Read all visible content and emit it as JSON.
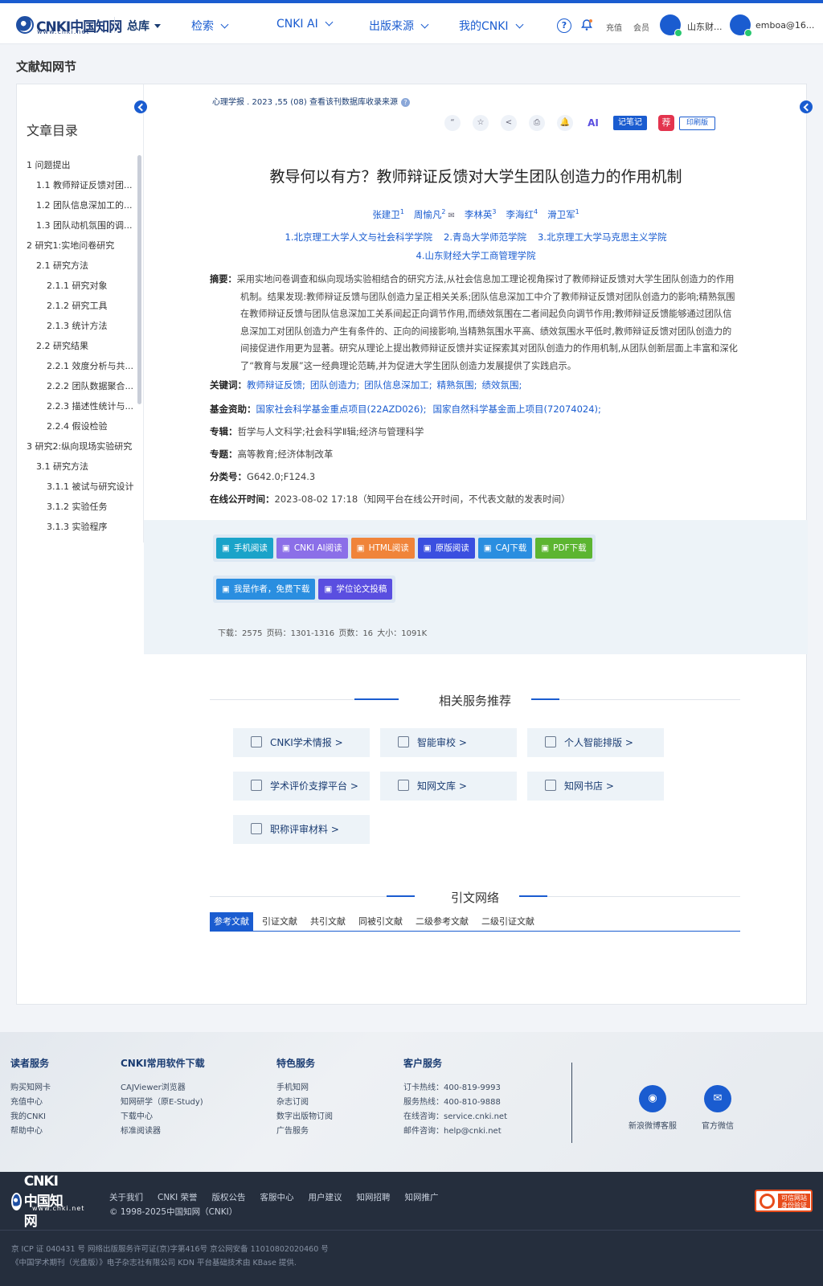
{
  "nav": {
    "logo_text": "CNKI中国知网",
    "logo_sub": "www.cnki.net",
    "items": [
      "总库",
      "检索",
      "CNKI AI",
      "出版来源",
      "我的CNKI"
    ],
    "recharge": "充值",
    "member": "会员",
    "institution": "山东财...",
    "user": "emboa@16..."
  },
  "page_title": "文献知网节",
  "sidebar": {
    "title": "文章目录",
    "toc": [
      {
        "level": 1,
        "text": "1 问题提出"
      },
      {
        "level": 2,
        "text": "1.1 教师辩证反馈对团..."
      },
      {
        "level": 2,
        "text": "1.2 团队信息深加工的..."
      },
      {
        "level": 2,
        "text": "1.3 团队动机氛围的调..."
      },
      {
        "level": 1,
        "text": "2 研究1:实地问卷研究"
      },
      {
        "level": 2,
        "text": "2.1 研究方法"
      },
      {
        "level": 3,
        "text": "2.1.1 研究对象"
      },
      {
        "level": 3,
        "text": "2.1.2 研究工具"
      },
      {
        "level": 3,
        "text": "2.1.3 统计方法"
      },
      {
        "level": 2,
        "text": "2.2 研究结果"
      },
      {
        "level": 3,
        "text": "2.2.1 效度分析与共..."
      },
      {
        "level": 3,
        "text": "2.2.2 团队数据聚合..."
      },
      {
        "level": 3,
        "text": "2.2.3 描述性统计与..."
      },
      {
        "level": 3,
        "text": "2.2.4 假设检验"
      },
      {
        "level": 1,
        "text": "3 研究2:纵向现场实验研究"
      },
      {
        "level": 2,
        "text": "3.1 研究方法"
      },
      {
        "level": 3,
        "text": "3.1.1 被试与研究设计"
      },
      {
        "level": 3,
        "text": "3.1.2 实验任务"
      },
      {
        "level": 3,
        "text": "3.1.3 实验程序"
      }
    ]
  },
  "article": {
    "source": "心理学报 . 2023 ,55 (08)  查看该刊数据库收录来源",
    "tools": {
      "cite": "“",
      "fav": "☆",
      "share": "<",
      "print": "⎙",
      "alert": "🔔",
      "ai": "AI",
      "note": "记笔记",
      "rec": "荐",
      "print_ver": "印刷版"
    },
    "title": "教导何以有方？教师辩证反馈对大学生团队创造力的作用机制",
    "authors": [
      {
        "name": "张建卫",
        "sup": "1"
      },
      {
        "name": "周愉凡",
        "sup": "2"
      },
      {
        "name": "李林英",
        "sup": "3"
      },
      {
        "name": "李海红",
        "sup": "4"
      },
      {
        "name": "滑卫军",
        "sup": "1"
      }
    ],
    "orgs": [
      "1.北京理工大学人文与社会科学学院",
      "2.青岛大学师范学院",
      "3.北京理工大学马克思主义学院",
      "4.山东财经大学工商管理学院"
    ],
    "abstract_label": "摘要：",
    "abstract": "采用实地问卷调查和纵向现场实验相结合的研究方法,从社会信息加工理论视角探讨了教师辩证反馈对大学生团队创造力的作用机制。结果发现:教师辩证反馈与团队创造力呈正相关关系;团队信息深加工中介了教师辩证反馈对团队创造力的影响;精熟氛围在教师辩证反馈与团队信息深加工关系间起正向调节作用,而绩效氛围在二者间起负向调节作用;教师辩证反馈能够通过团队信息深加工对团队创造力产生有条件的、正向的间接影响,当精熟氛围水平高、绩效氛围水平低时,教师辩证反馈对团队创造力的间接促进作用更为显著。研究从理论上提出教师辩证反馈并实证探索其对团队创造力的作用机制,从团队创新层面上丰富和深化了“教育与发展”这一经典理论范畴,并为促进大学生团队创造力发展提供了实践启示。",
    "keywords_label": "关键词：",
    "keywords": [
      "教师辩证反馈;",
      "团队创造力;",
      "团队信息深加工;",
      "精熟氛围;",
      "绩效氛围;"
    ],
    "fund_label": "基金资助：",
    "funds": [
      "国家社会科学基金重点项目(22AZD026);",
      "国家自然科学基金面上项目(72074024);"
    ],
    "series_label": "专辑：",
    "series": "哲学与人文科学;社会科学Ⅱ辑;经济与管理科学",
    "topic_label": "专题：",
    "topic": "高等教育;经济体制改革",
    "class_label": "分类号：",
    "class": "G642.0;F124.3",
    "online_label": "在线公开时间：",
    "online": "2023-08-02 17:18（知网平台在线公开时间，不代表文献的发表时间）"
  },
  "download": {
    "buttons": [
      {
        "label": "手机阅读",
        "color": "#1aa3c9"
      },
      {
        "label": "CNKI AI阅读",
        "color": "#8b6fe8"
      },
      {
        "label": "HTML阅读",
        "color": "#f0843a"
      },
      {
        "label": "原版阅读",
        "color": "#3a4fe0"
      },
      {
        "label": "CAJ下载",
        "color": "#2a8ee0"
      },
      {
        "label": "PDF下载",
        "color": "#5cb531"
      }
    ],
    "buttons2": [
      {
        "label": "我是作者，免费下载",
        "color": "#2a8ee0"
      },
      {
        "label": "学位论文投稿",
        "color": "#5a4ee0"
      }
    ],
    "stats": "下载：2575    页码：1301-1316    页数：16    大小：1091K"
  },
  "services": {
    "title": "相关服务推荐",
    "items": [
      "CNKI学术情报 >",
      "智能审校 >",
      "个人智能排版 >",
      "学术评价支撑平台 >",
      "知网文库 >",
      "知网书店 >",
      "职称评审材料 >"
    ]
  },
  "citation": {
    "title": "引文网络",
    "tabs": [
      "参考文献",
      "引证文献",
      "共引文献",
      "同被引文献",
      "二级参考文献",
      "二级引证文献"
    ]
  },
  "footer": {
    "cols": [
      {
        "title": "读者服务",
        "items": [
          "购买知网卡",
          "充值中心",
          "我的CNKI",
          "帮助中心"
        ]
      },
      {
        "title": "CNKI常用软件下载",
        "items": [
          "CAJViewer浏览器",
          "知网研学（原E-Study)",
          "下载中心",
          "标准阅读器"
        ]
      },
      {
        "title": "特色服务",
        "items": [
          "手机知网",
          "杂志订阅",
          "数字出版物订阅",
          "广告服务"
        ]
      },
      {
        "title": "客户服务",
        "items": [
          "订卡热线：400-819-9993",
          "服务热线：400-810-9888",
          "在线咨询：service.cnki.net",
          "邮件咨询：help@cnki.net"
        ]
      }
    ],
    "weibo": "新浪微博客服",
    "wechat": "官方微信",
    "links": [
      "关于我们",
      "CNKI 荣誉",
      "版权公告",
      "客服中心",
      "用户建议",
      "知网招聘",
      "知网推广"
    ],
    "copyright": "© 1998-2025中国知网（CNKI）",
    "icp1": "京 ICP 证 040431 号  网络出版服务许可证(京)字第416号  京公网安备 11010802020460 号",
    "icp2": "《中国学术期刊（光盘版）》电子杂志社有限公司  KDN 平台基础技术由 KBase 提供.",
    "trust": "可信网站 身份验证"
  }
}
